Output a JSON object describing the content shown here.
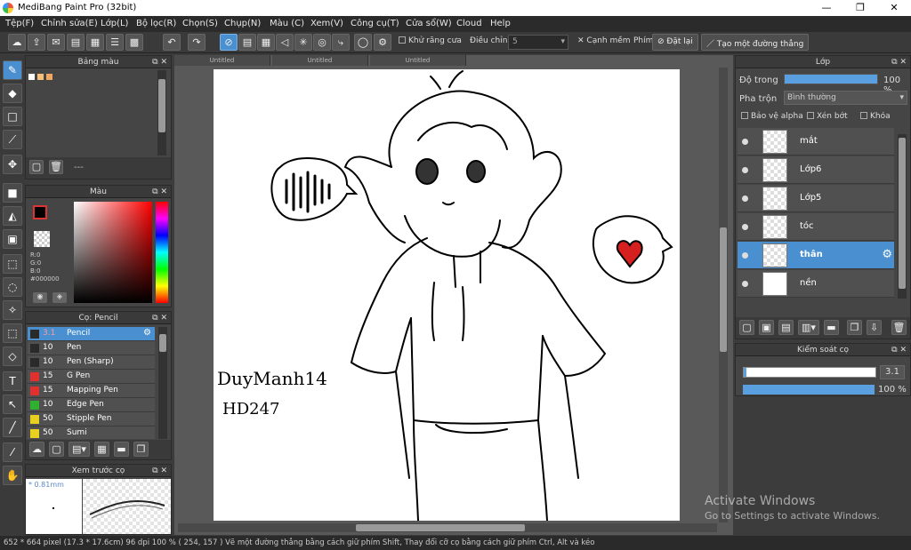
{
  "window": {
    "title": "MediBang Paint Pro (32bit)",
    "minimize": "—",
    "maximize": "❐",
    "close": "✕"
  },
  "menu": [
    "Tệp(F)",
    "Chỉnh sửa(E)",
    "Lớp(L)",
    "Bộ lọc(R)",
    "Chọn(S)",
    "Chụp(N)",
    "Màu (C)",
    "Xem(V)",
    "Công cụ(T)",
    "Cửa sổ(W)",
    "Cloud",
    "Help"
  ],
  "toolbar": {
    "antialias_label": "Khử răng cưa",
    "adjust_label": "Điều chỉnh",
    "adjust_value": "5",
    "smooth_label": "Cạnh mềm",
    "key_label": "Phím",
    "reset_label": "Đặt lại",
    "line_label": "Tạo một đường thẳng"
  },
  "color_palette": {
    "title": "Bảng màu",
    "swatches": [
      "#ffffff",
      "#f6c07a",
      "#f0a860"
    ],
    "footer_text": "---"
  },
  "color": {
    "title": "Màu",
    "r": "R:0",
    "g": "G:0",
    "b": "B:0",
    "hex": "#000000",
    "fg": "#000000",
    "bg": "#ffffff"
  },
  "brush": {
    "title": "Cọ: Pencil",
    "items": [
      {
        "size": "3.1",
        "name": "Pencil",
        "color": "#2a2a2a",
        "selected": true
      },
      {
        "size": "10",
        "name": "Pen",
        "color": "#2a2a2a"
      },
      {
        "size": "10",
        "name": "Pen (Sharp)",
        "color": "#2a2a2a"
      },
      {
        "size": "15",
        "name": "G Pen",
        "color": "#e03030"
      },
      {
        "size": "15",
        "name": "Mapping Pen",
        "color": "#e03030"
      },
      {
        "size": "10",
        "name": "Edge Pen",
        "color": "#30b030"
      },
      {
        "size": "50",
        "name": "Stipple Pen",
        "color": "#e8d020"
      },
      {
        "size": "50",
        "name": "Sumi",
        "color": "#e8d020"
      }
    ]
  },
  "preview": {
    "title": "Xem trước cọ",
    "size": "* 0.81mm"
  },
  "canvas": {
    "tabs": [
      "Untitled",
      "Untitled",
      "Untitled"
    ],
    "signature": "DuyManh14 HD247"
  },
  "layers": {
    "title": "Lớp",
    "opacity_label": "Độ trong",
    "opacity_value": "100 %",
    "opacity": 1.0,
    "blend_label": "Pha trộn",
    "blend_value": "Bình thường",
    "protect_alpha": "Bảo vệ alpha",
    "clip": "Xén bớt",
    "lock": "Khóa",
    "items": [
      {
        "name": "mắt",
        "selected": false
      },
      {
        "name": "Lớp6",
        "selected": false
      },
      {
        "name": "Lớp5",
        "selected": false
      },
      {
        "name": "tóc",
        "selected": false
      },
      {
        "name": "thân",
        "selected": true
      },
      {
        "name": "nền",
        "selected": false
      }
    ]
  },
  "brush_control": {
    "title": "Kiểm soát cọ",
    "size_value": "3.1",
    "size_level": 0.02,
    "opacity_value": "100 %",
    "opacity_level": 1.0
  },
  "status": "652 * 664 pixel   (17.3 * 17.6cm)   96 dpi   100 %   ( 254, 157 )   Vẽ một đường thẳng bằng cách giữ phím Shift, Thay đổi cỡ cọ bằng cách giữ phím Ctrl, Alt và kéo",
  "watermark": {
    "line1": "Activate Windows",
    "line2": "Go to Settings to activate Windows."
  }
}
